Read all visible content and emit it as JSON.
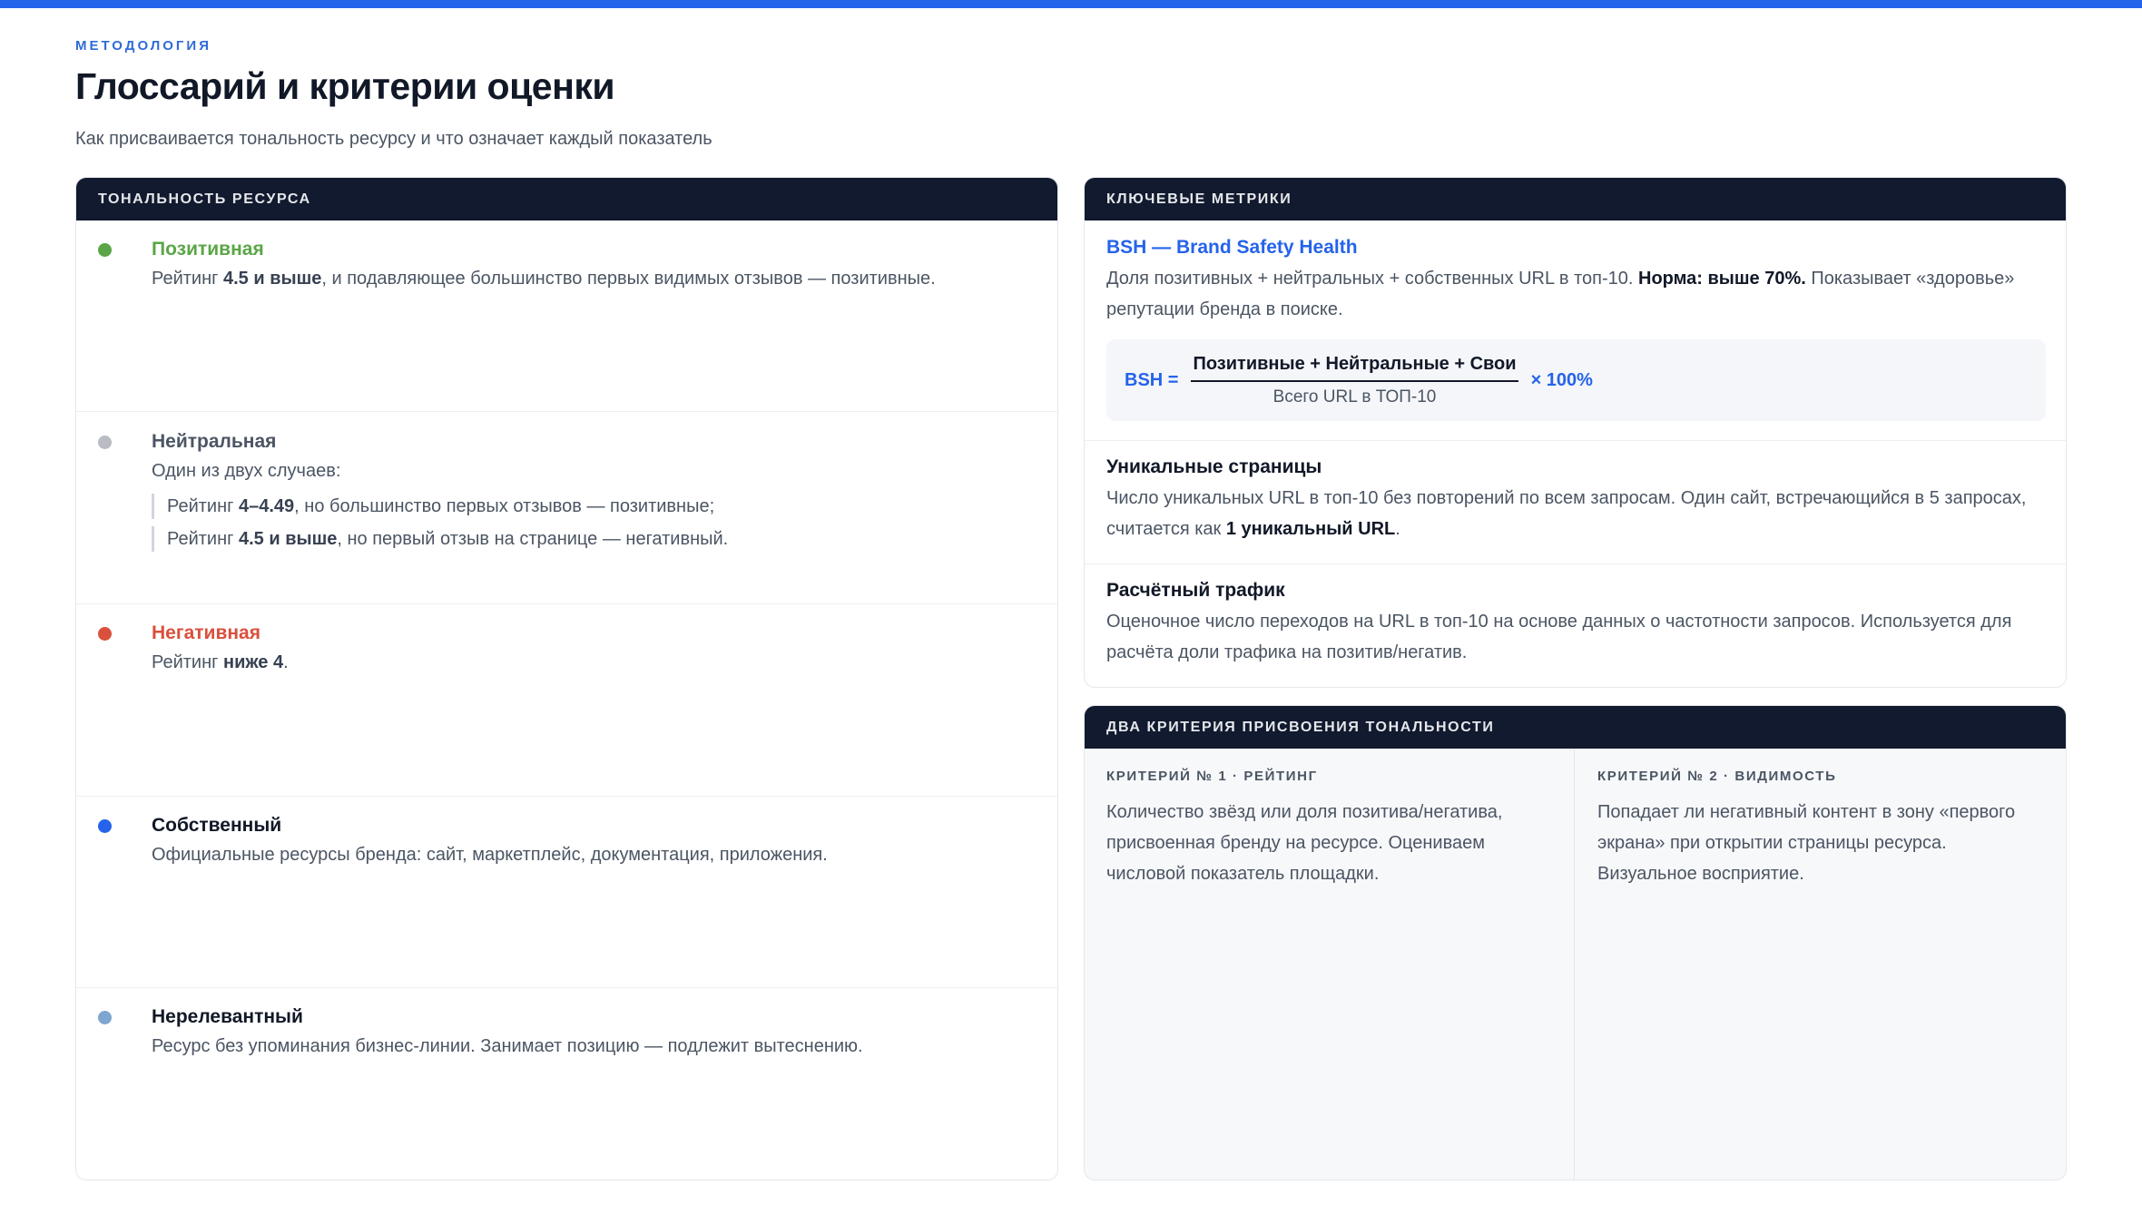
{
  "header": {
    "eyebrow": "МЕТОДОЛОГИЯ",
    "title": "Глоссарий и критерии оценки",
    "subtitle": "Как присваивается тональность ресурсу и что означает каждый показатель"
  },
  "colors": {
    "accent": "#2563eb",
    "positive": "#5aa646",
    "neutral": "#b9bcc2",
    "negative": "#d9503c",
    "own": "#2563eb",
    "irrelevant": "#7ea6cf",
    "header_bg": "#111a2e"
  },
  "tonality": {
    "heading": "ТОНАЛЬНОСТЬ РЕСУРСА",
    "items": [
      {
        "name": "Позитивная",
        "desc_prefix": "Рейтинг ",
        "desc_bold": "4.5 и выше",
        "desc_suffix": ", и подавляющее большинство первых видимых отзывов — позитивные."
      },
      {
        "name": "Нейтральная",
        "desc": "Один из двух случаев:",
        "cases": [
          {
            "prefix": "Рейтинг ",
            "bold": "4–4.49",
            "suffix": ", но большинство первых отзывов — позитивные;"
          },
          {
            "prefix": "Рейтинг ",
            "bold": "4.5 и выше",
            "suffix": ", но первый отзыв на странице — негативный."
          }
        ]
      },
      {
        "name": "Негативная",
        "desc_prefix": "Рейтинг ",
        "desc_bold": "ниже 4",
        "desc_suffix": "."
      },
      {
        "name": "Собственный",
        "desc": "Официальные ресурсы бренда: сайт, маркетплейс, документация, приложения."
      },
      {
        "name": "Нерелевантный",
        "desc": "Ресурс без упоминания бизнес-линии. Занимает позицию — подлежит вытеснению."
      }
    ]
  },
  "metrics": {
    "heading": "КЛЮЧЕВЫЕ МЕТРИКИ",
    "bsh": {
      "name": "BSH — Brand Safety Health",
      "desc_prefix": "Доля позитивных + нейтральных + собственных URL в топ-10. ",
      "desc_bold": "Норма: выше 70%.",
      "desc_suffix": " Показывает «здоровье» репутации бренда в поиске.",
      "formula_lhs": "BSH =",
      "formula_num": "Позитивные + Нейтральные + Свои",
      "formula_den": "Всего URL в ТОП-10",
      "formula_rhs": "× 100%"
    },
    "unique": {
      "name": "Уникальные страницы",
      "desc_prefix": "Число уникальных URL в топ-10 без повторений по всем запросам. Один сайт, встречающийся в 5 запросах, считается как ",
      "desc_bold": "1 уникальный URL",
      "desc_suffix": "."
    },
    "traffic": {
      "name": "Расчётный трафик",
      "desc": "Оценочное число переходов на URL в топ-10 на основе данных о частотности запросов. Используется для расчёта доли трафика на позитив/негатив."
    }
  },
  "criteria": {
    "heading": "ДВА КРИТЕРИЯ ПРИСВОЕНИЯ ТОНАЛЬНОСТИ",
    "items": [
      {
        "label": "КРИТЕРИЙ № 1 · РЕЙТИНГ",
        "text": "Количество звёзд или доля позитива/негатива, присвоенная бренду на ресурсе. Оцениваем числовой показатель площадки."
      },
      {
        "label": "КРИТЕРИЙ № 2 · ВИДИМОСТЬ",
        "text": "Попадает ли негативный контент в зону «первого экрана» при открытии страницы ресурса. Визуальное восприятие."
      }
    ]
  }
}
